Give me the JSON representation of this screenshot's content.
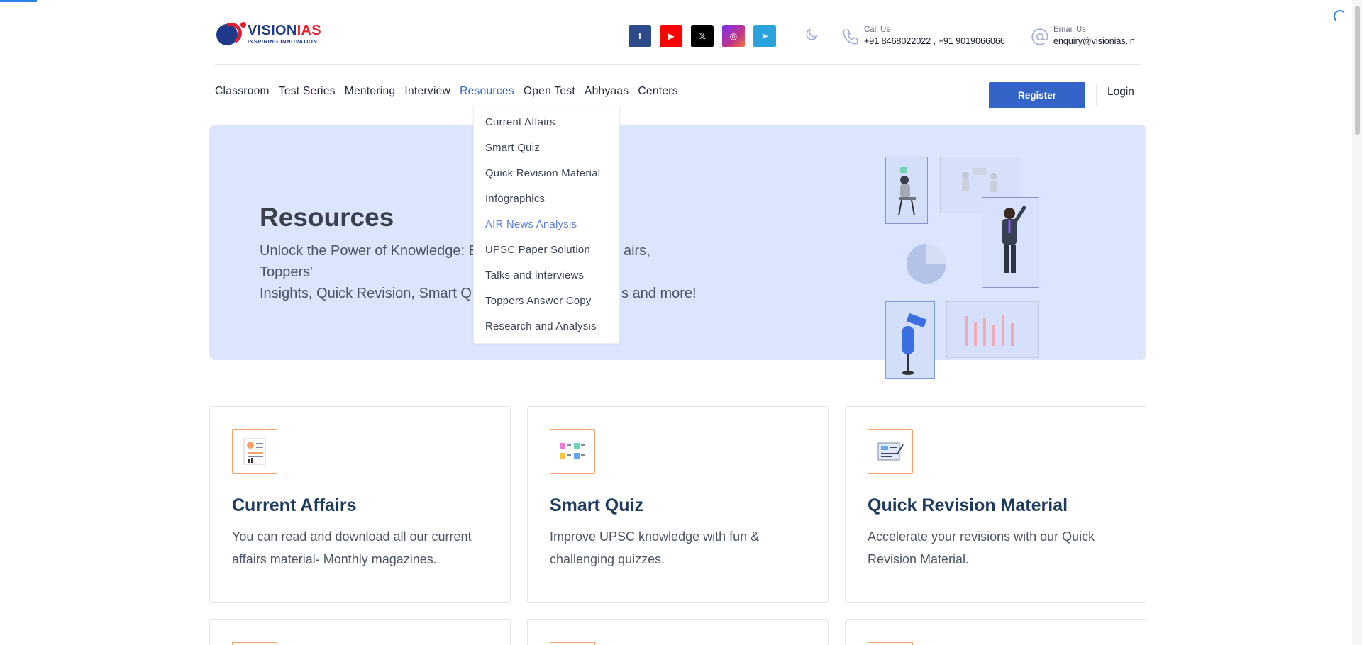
{
  "header": {
    "logo": {
      "name_part1": "VISION",
      "name_part2": "IAS",
      "tagline": "INSPIRING INNOVATION"
    },
    "socials": [
      {
        "name": "facebook",
        "glyph": "f"
      },
      {
        "name": "youtube",
        "glyph": "▶"
      },
      {
        "name": "x",
        "glyph": "𝕏"
      },
      {
        "name": "instagram",
        "glyph": "◎"
      },
      {
        "name": "telegram",
        "glyph": "➤"
      }
    ],
    "call": {
      "label": "Call Us",
      "value": "+91 8468022022 , +91 9019066066"
    },
    "email": {
      "label": "Email Us",
      "value": "enquiry@visionias.in"
    }
  },
  "nav": {
    "items": [
      "Classroom",
      "Test Series",
      "Mentoring",
      "Interview",
      "Resources",
      "Open Test",
      "Abhyaas",
      "Centers"
    ],
    "active": "Resources",
    "register_label": "Register",
    "login_label": "Login"
  },
  "dropdown": {
    "items": [
      "Current Affairs",
      "Smart Quiz",
      "Quick Revision Material",
      "Infographics",
      "AIR News Analysis",
      "UPSC Paper Solution",
      "Talks and Interviews",
      "Toppers Answer Copy",
      "Research and Analysis"
    ],
    "highlighted": "AIR News Analysis"
  },
  "hero": {
    "title": "Resources",
    "subtitle_line1": "Unlock the Power of Knowledge: E",
    "subtitle_line1_end": "airs, Toppers'",
    "subtitle_line2": "Insights, Quick Revision, Smart Q",
    "subtitle_line2_end": "s and more!"
  },
  "cards": [
    {
      "title": "Current Affairs",
      "text": "You can read and download all our current affairs material- Monthly magazines."
    },
    {
      "title": "Smart Quiz",
      "text": "Improve UPSC knowledge with fun & challenging quizzes."
    },
    {
      "title": "Quick Revision Material",
      "text": "Accelerate your revisions with our Quick Revision Material."
    }
  ],
  "colors": {
    "brand_blue": "#3463c8",
    "hero_bg": "#dbe5fd",
    "accent_orange": "#f2a36b",
    "title_navy": "#1e3a5f"
  }
}
